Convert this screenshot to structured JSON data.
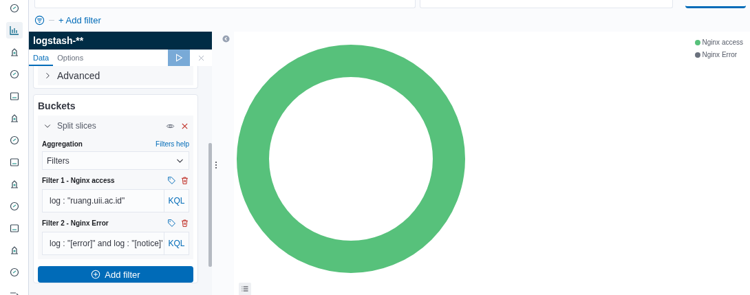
{
  "filter_bar": {
    "add_filter": "+ Add filter"
  },
  "editor": {
    "index_pattern": "logstash-**",
    "tabs": [
      {
        "label": "Data",
        "selected": true
      },
      {
        "label": "Options",
        "selected": false
      }
    ],
    "advanced": {
      "label": "Advanced",
      "expanded": false
    },
    "buckets": {
      "title": "Buckets",
      "split": {
        "label": "Split slices",
        "expanded": true
      },
      "aggregation": {
        "label": "Aggregation",
        "help": "Filters help",
        "value": "Filters"
      },
      "filters": [
        {
          "label": "Filter 1 - Nginx access",
          "query": "log : \"ruang.uii.ac.id\"",
          "language": "KQL"
        },
        {
          "label": "Filter 2 - Nginx Error",
          "query": "log : \"[error]\" and log : \"[notice]'",
          "language": "KQL"
        }
      ],
      "add_filter": "Add filter"
    }
  },
  "legend": [
    {
      "label": "Nginx access",
      "color": "#57c17b"
    },
    {
      "label": "Nginx Error",
      "color": "#6a717d"
    }
  ]
}
